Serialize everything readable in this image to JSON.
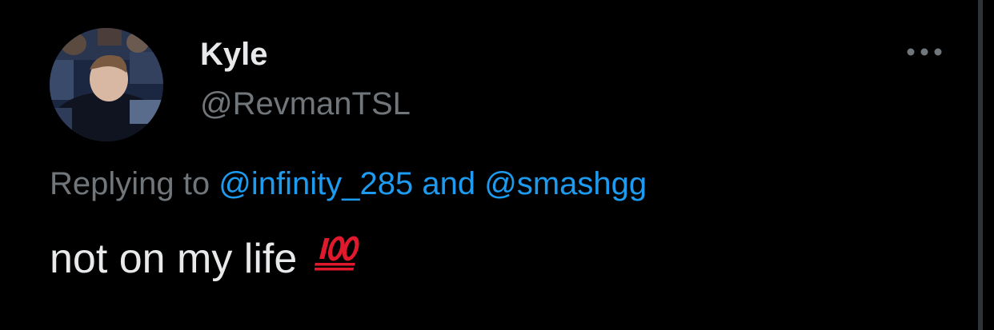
{
  "tweet": {
    "author": {
      "display_name": "Kyle",
      "handle": "@RevmanTSL"
    },
    "reply_context": {
      "prefix": "Replying to",
      "mentions": [
        "@infinity_285",
        "@smashgg"
      ],
      "conjunction": "and"
    },
    "text": "not on my life",
    "emoji": "hundred-points-icon",
    "more_icon": "more-horizontal-icon"
  },
  "colors": {
    "background": "#000000",
    "primary_text": "#e7e9ea",
    "secondary_text": "#71767b",
    "link": "#1d9bf0",
    "emoji_red": "#e0192d"
  }
}
